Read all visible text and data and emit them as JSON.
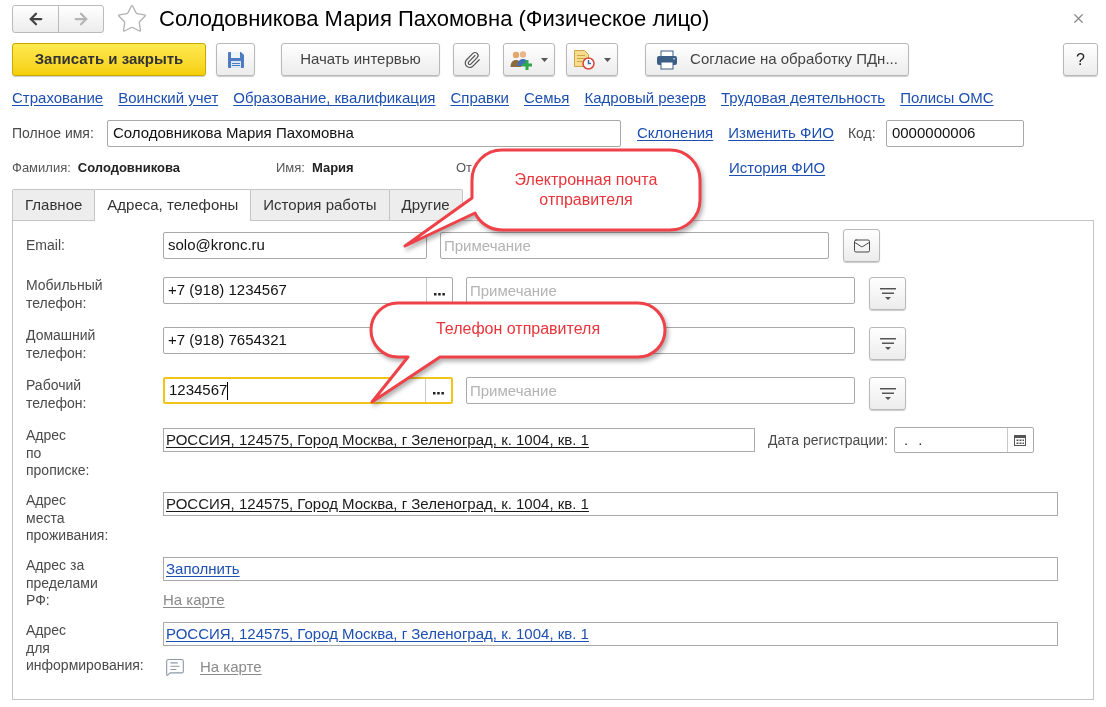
{
  "window": {
    "title": "Солодовникова Мария Пахомовна (Физическое лицо)",
    "favorite": false
  },
  "navigation": {
    "back": {
      "disabled": false
    },
    "forward": {
      "disabled": true
    }
  },
  "toolbar": {
    "save_and_close": "Записать и закрыть",
    "interview": "Начать интервью",
    "consent": "Согласие на обработку ПДн...",
    "help": "?"
  },
  "links": [
    "Страхование",
    "Воинский учет",
    "Образование, квалификация",
    "Справки",
    "Семья",
    "Кадровый резерв",
    "Трудовая деятельность",
    "Полисы ОМС"
  ],
  "full_name": {
    "label": "Полное имя:",
    "value": "Солодовникова Мария Пахомовна",
    "links": [
      "Склонения",
      "Изменить ФИО"
    ]
  },
  "code": {
    "label": "Код:",
    "value": "0000000006"
  },
  "name_parts": [
    {
      "label": "Фамилия:",
      "value": "Солодовникова"
    },
    {
      "label": "Имя:",
      "value": "Мария"
    },
    {
      "label": "От"
    }
  ],
  "name_history_link": "История ФИО",
  "tabs": [
    {
      "label": "Главное",
      "selected": false
    },
    {
      "label": "Адреса, телефоны",
      "selected": true
    },
    {
      "label": "История работы",
      "selected": false
    },
    {
      "label": "Другие",
      "selected": false
    }
  ],
  "contacts": [
    {
      "kind": "email",
      "label": "Email:",
      "value": "solo@kronc.ru",
      "focused": false,
      "note": {
        "placeholder": "Примечание"
      }
    },
    {
      "kind": "phone",
      "label": "Мобильный\nтелефон:",
      "value": "+7 (918) 1234567",
      "focused": false,
      "picker": true,
      "note": {
        "placeholder": "Примечание"
      }
    },
    {
      "kind": "phone",
      "label": "Домашний\nтелефон:",
      "value": "+7 (918) 7654321",
      "focused": false
    },
    {
      "kind": "phone",
      "label": "Рабочий\nтелефон:",
      "value": "1234567",
      "focused": true,
      "picker": true,
      "note": {
        "placeholder": "Примечание"
      }
    }
  ],
  "addresses": [
    {
      "kind": "registration",
      "label": "Адрес\nпо\nпрописке:",
      "value": "РОССИЯ, 124575, Город Москва, г Зеленоград, к. 1004, кв. 1",
      "link": false,
      "date": {
        "label": "Дата регистрации:",
        "value": ". ."
      }
    },
    {
      "kind": "residence",
      "label": "Адрес\nместа\nпроживания:",
      "value": "РОССИЯ, 124575, Город Москва, г Зеленоград, к. 1004, кв. 1",
      "link": false
    },
    {
      "kind": "foreign",
      "label": "Адрес за\nпределами\nРФ:",
      "value": "Заполнить",
      "link": true,
      "map_link": "На карте"
    },
    {
      "kind": "informing",
      "label": "Адрес\nдля\nинформирования:",
      "value": "РОССИЯ, 124575, Город Москва, г Зеленоград, к. 1004, кв. 1",
      "link": true,
      "map_link": "На карте"
    }
  ],
  "callouts": [
    {
      "text": "Электронная почта отправителя"
    },
    {
      "text": "Телефон отправителя"
    }
  ]
}
